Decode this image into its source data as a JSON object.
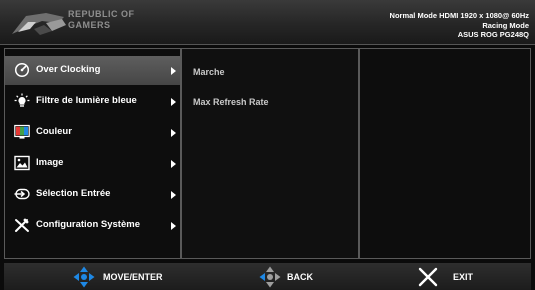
{
  "header": {
    "brand_line1": "REPUBLIC OF",
    "brand_line2": "GAMERS",
    "status_line1": "Normal Mode HDMI 1920 x 1080@ 60Hz",
    "status_line2": "Racing Mode",
    "status_line3": "ASUS ROG PG248Q"
  },
  "menu": {
    "items": [
      {
        "label": "Over Clocking",
        "icon": "speedometer-icon",
        "active": true
      },
      {
        "label": "Filtre de lumière bleue",
        "icon": "bulb-icon"
      },
      {
        "label": "Couleur",
        "icon": "color-icon"
      },
      {
        "label": "Image",
        "icon": "image-icon"
      },
      {
        "label": "Sélection Entrée",
        "icon": "input-icon"
      },
      {
        "label": "Configuration Système",
        "icon": "tools-icon"
      }
    ]
  },
  "submenu": {
    "items": [
      {
        "label": "Marche"
      },
      {
        "label": "Max Refresh Rate"
      }
    ]
  },
  "footer": {
    "move_enter": "MOVE/ENTER",
    "back": "BACK",
    "exit": "EXIT"
  },
  "colors": {
    "accent_blue": "#1e88e5",
    "active_item_bg": "#555555",
    "panel_border": "#5a5a5a"
  }
}
